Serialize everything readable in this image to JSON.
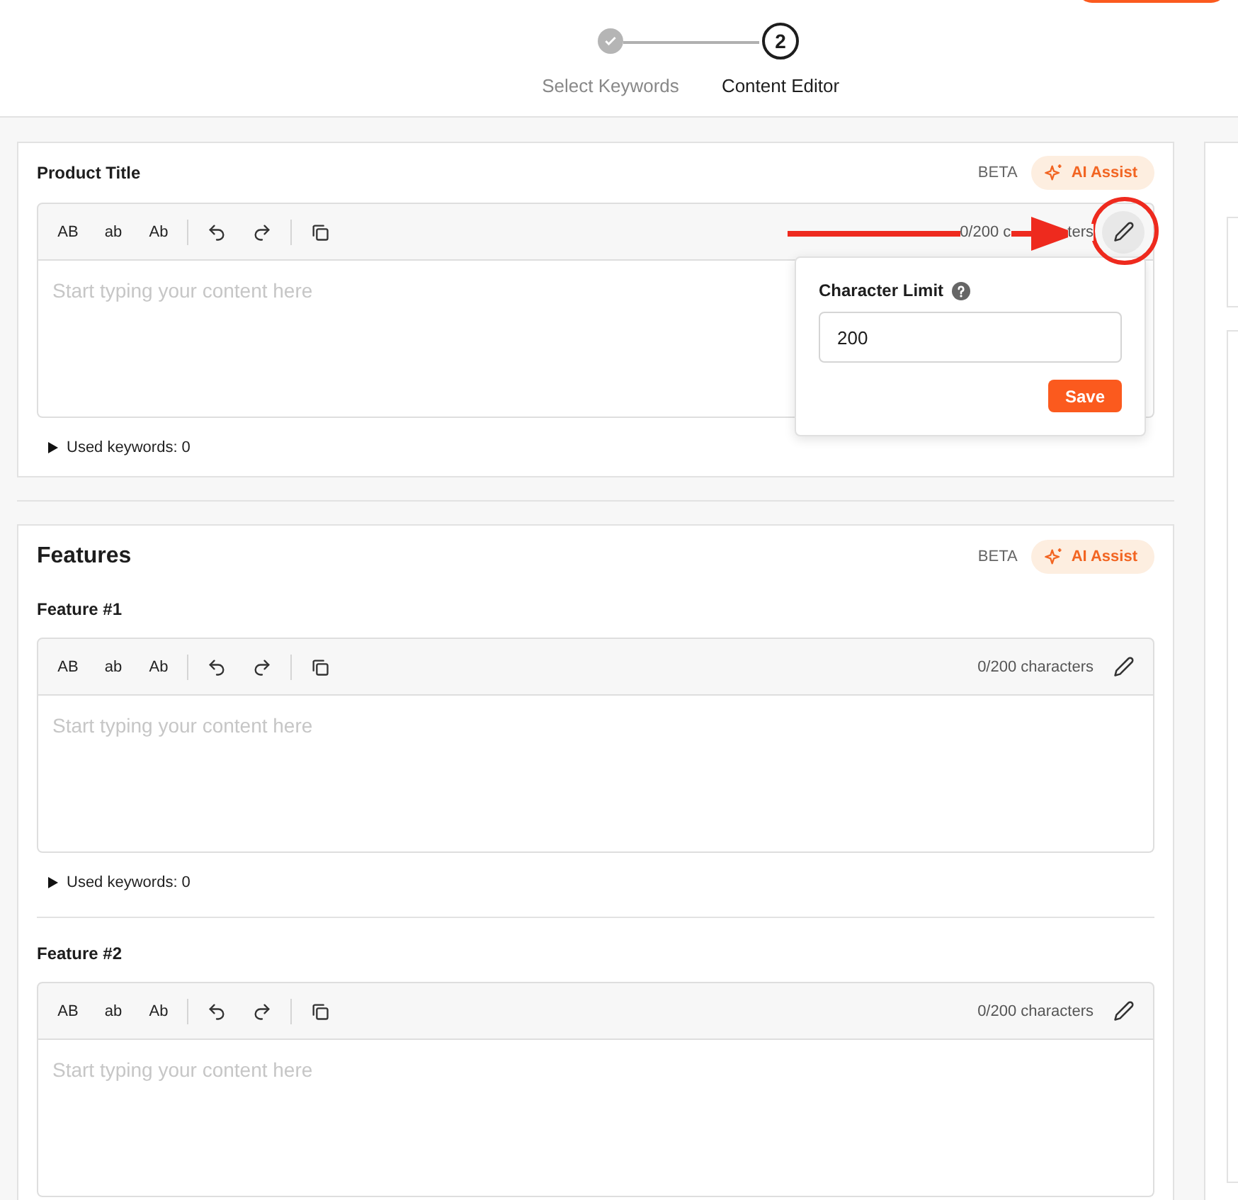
{
  "stepper": [
    {
      "label": "Select Keywords",
      "completed": true
    },
    {
      "label": "Content Editor",
      "number": "2",
      "completed": false
    }
  ],
  "sections": [
    {
      "title": "Product Title",
      "kind": "single",
      "badge": "BETA",
      "ai_button": "AI Assist",
      "fields": [
        {
          "format_buttons": [
            "AB",
            "ab",
            "Ab"
          ],
          "count": [
            "0/200 c",
            "ters"
          ],
          "placeholder": "Start typing your content here",
          "used_keywords": "Used keywords: 0",
          "expanded": false,
          "editing": true
        }
      ]
    },
    {
      "title": "Features",
      "kind": "group",
      "badge": "BETA",
      "ai_button": "AI Assist",
      "fields": [
        {
          "label": "Feature #1",
          "format_buttons": [
            "AB",
            "ab",
            "Ab"
          ],
          "count": [
            "0/200 characters"
          ],
          "placeholder": "Start typing your content here",
          "used_keywords": "Used keywords: 0",
          "expanded": false,
          "editing": false
        },
        {
          "label": "Feature #2",
          "format_buttons": [
            "AB",
            "ab",
            "Ab"
          ],
          "count": [
            "0/200 characters"
          ],
          "placeholder": "Start typing your content here",
          "editing": false
        }
      ]
    }
  ],
  "popover": {
    "label": "Character Limit",
    "value": "200",
    "button": "Save"
  }
}
